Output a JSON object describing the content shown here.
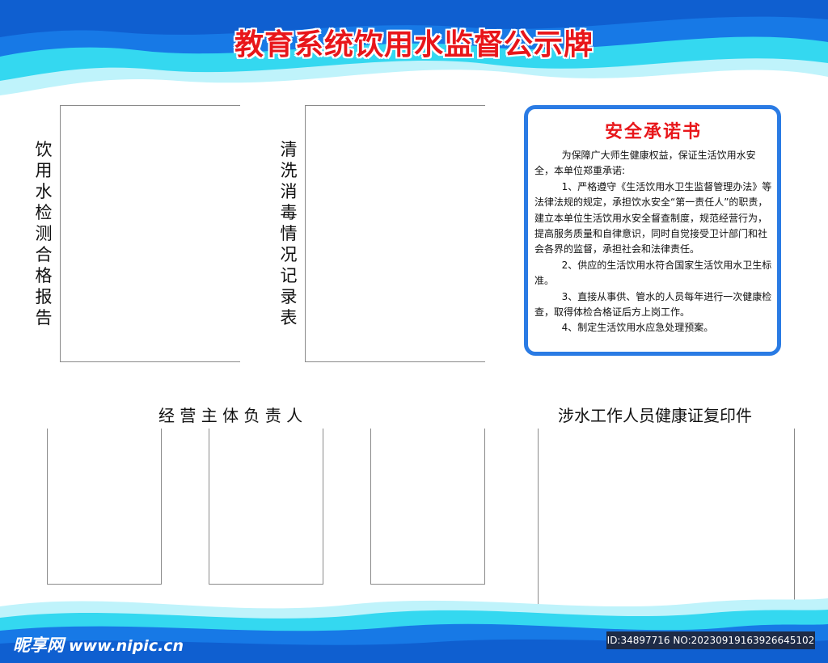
{
  "colors": {
    "title_red": "#e8161a",
    "frame_blue": "#2a7be4",
    "wave_dark_blue": "#1779e6",
    "wave_cyan": "#34d8f0",
    "wave_light": "#bff3fb"
  },
  "header": {
    "title": "教育系统饮用水监督公示牌"
  },
  "panels": {
    "water_test": {
      "label": "饮用水检测合格报告"
    },
    "cleaning": {
      "label": "清洗消毒情况记录表"
    }
  },
  "notice": {
    "title": "安全承诺书",
    "paragraphs": [
      "为保障广大师生健康权益，保证生活饮用水安全，本单位郑重承诺:",
      "1、严格遵守《生活饮用水卫生监督管理办法》等法律法规的规定，承担饮水安全“第一责任人”的职责，建立本单位生活饮用水安全督查制度，规范经营行为，提高服务质量和自律意识，同时自觉接受卫计部门和社会各界的监督，承担社会和法律责任。",
      "2、供应的生活饮用水符合国家生活饮用水卫生标准。",
      "3、直接从事供、管水的人员每年进行一次健康检查，取得体检合格证后方上岗工作。",
      "4、制定生活饮用水应急处理预案。"
    ]
  },
  "sections": {
    "responsible": {
      "label": "经 营 主 体 负 责 人"
    },
    "health_cert": {
      "label": "涉水工作人员健康证复印件"
    }
  },
  "footer": {
    "logo_cn": "昵享网",
    "logo_url": "www.nipic.cn",
    "id_text": "ID:34897716 NO:20230919163926645102"
  }
}
